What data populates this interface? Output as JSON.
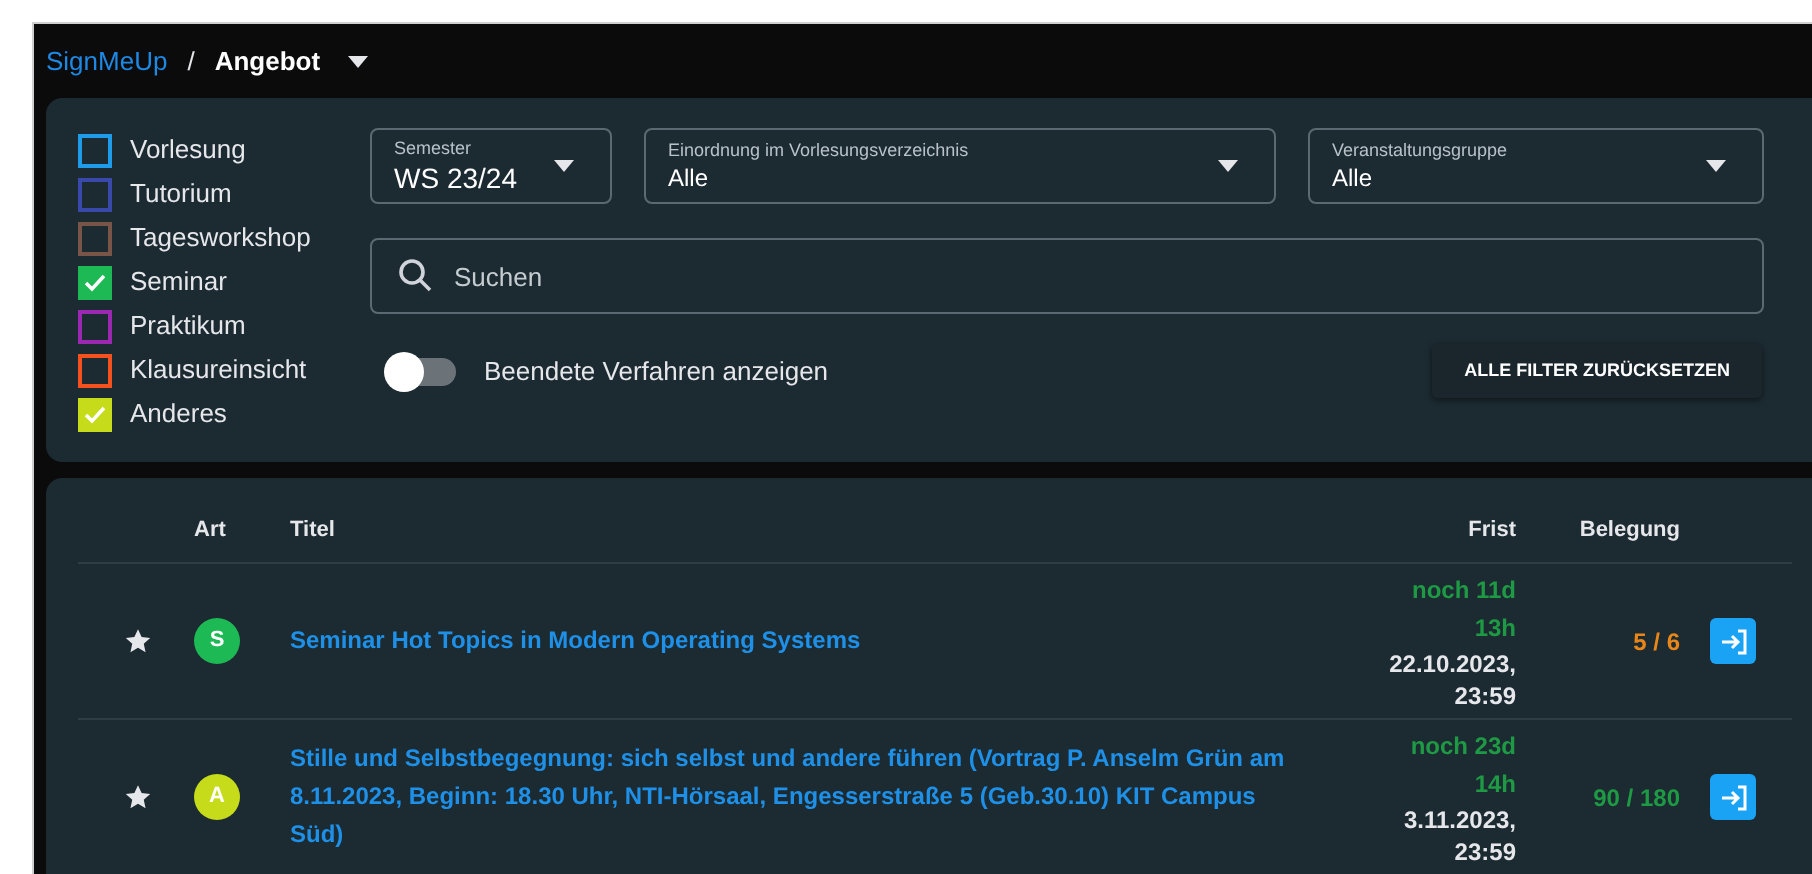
{
  "breadcrumb": {
    "home": "SignMeUp",
    "separator": "/",
    "current": "Angebot"
  },
  "types": [
    {
      "label": "Vorlesung",
      "checked": false,
      "color": "#1e9be9"
    },
    {
      "label": "Tutorium",
      "checked": false,
      "color": "#3949ab"
    },
    {
      "label": "Tagesworkshop",
      "checked": false,
      "color": "#795548"
    },
    {
      "label": "Seminar",
      "checked": true,
      "color": "#1db954"
    },
    {
      "label": "Praktikum",
      "checked": false,
      "color": "#9c27b0"
    },
    {
      "label": "Klausureinsicht",
      "checked": false,
      "color": "#f4511e"
    },
    {
      "label": "Anderes",
      "checked": true,
      "color": "#c6dc1a"
    }
  ],
  "selects": [
    {
      "label": "Semester",
      "value": "WS 23/24"
    },
    {
      "label": "Einordnung im Vorlesungsverzeichnis",
      "value": "Alle"
    },
    {
      "label": "Veranstaltungsgruppe",
      "value": "Alle"
    }
  ],
  "search": {
    "placeholder": "Suchen"
  },
  "show_finished": {
    "label": "Beendete Verfahren anzeigen",
    "on": false
  },
  "reset_button": "ALLE FILTER ZURÜCKSETZEN",
  "table": {
    "columns": [
      "Art",
      "Titel",
      "Frist",
      "Belegung"
    ],
    "rows": [
      {
        "favorite": false,
        "type_letter": "S",
        "color": "#1db954",
        "title": "Seminar Hot Topics in Modern Operating Systems",
        "remaining": "noch 11d 13h",
        "deadline": "22.10.2023, 23:59",
        "occupancy": {
          "text": "5 / 6",
          "color": "#e8861a"
        }
      },
      {
        "favorite": false,
        "type_letter": "A",
        "color": "#c6dc1a",
        "title": "Stille und Selbstbegegnung: sich selbst und andere führen (Vortrag P. Anselm Grün am 8.11.2023, Beginn: 18.30 Uhr, NTI-Hörsaal, Engesserstraße 5 (Geb.30.10) KIT Campus Süd)",
        "remaining": "noch 23d 14h",
        "deadline": "3.11.2023, 23:59",
        "occupancy": {
          "text": "90 / 180",
          "color": "#1e9a44"
        }
      }
    ]
  }
}
